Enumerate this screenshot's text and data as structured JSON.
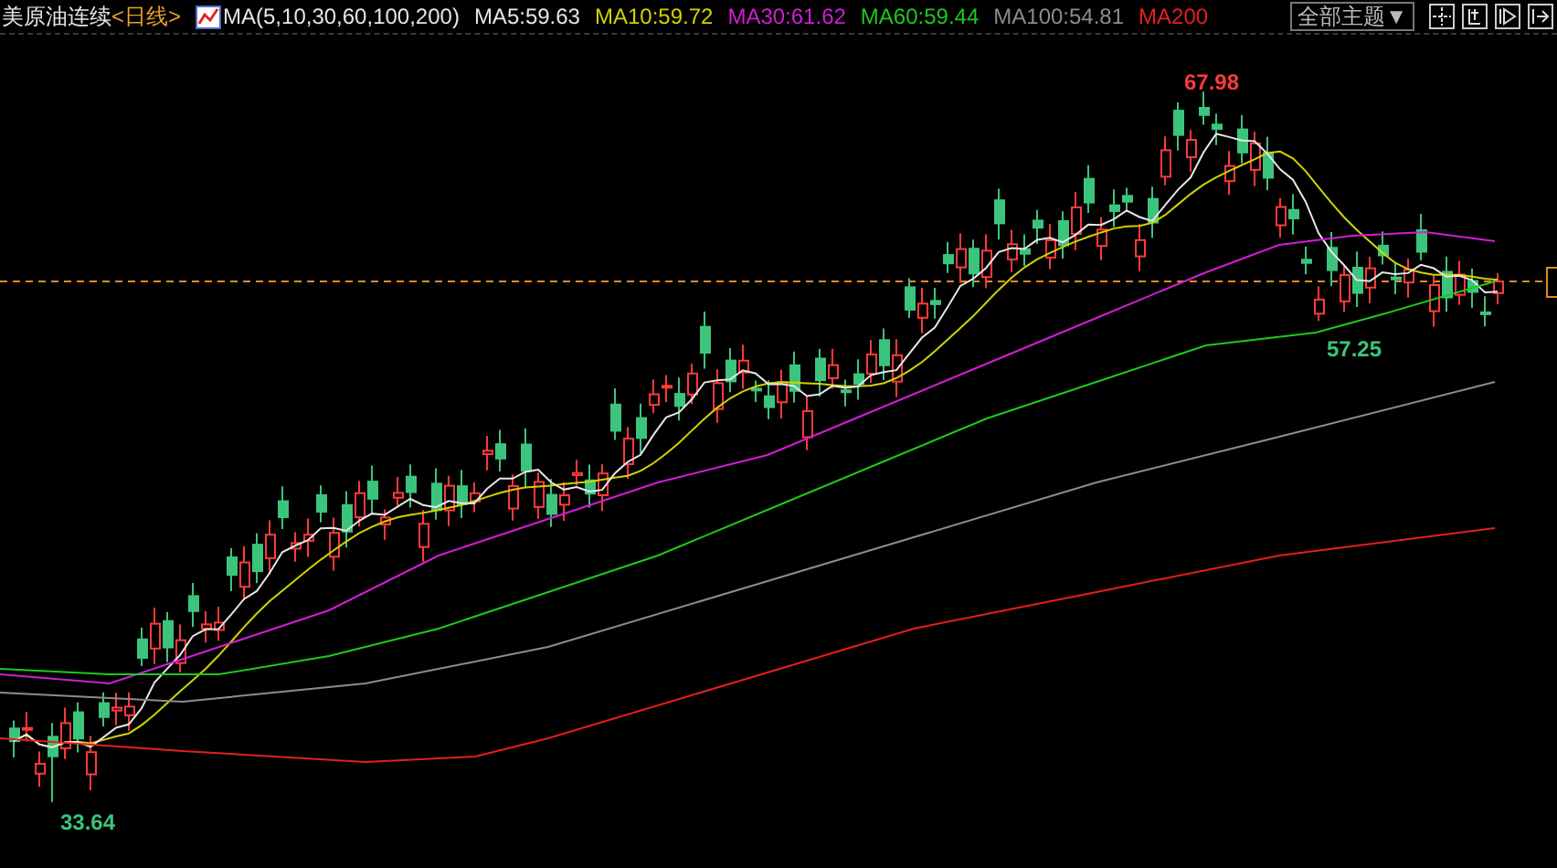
{
  "header": {
    "title": "美原油连续",
    "period": "<日线>",
    "indicator": "MA(5,10,30,60,100,200)",
    "ma_values": [
      {
        "label": "MA5:59.63",
        "color": "#e6e6e6"
      },
      {
        "label": "MA10:59.72",
        "color": "#d2d200"
      },
      {
        "label": "MA30:61.62",
        "color": "#d21ed2"
      },
      {
        "label": "MA60:59.44",
        "color": "#1ec81e"
      },
      {
        "label": "MA100:54.81",
        "color": "#8c8c8c"
      },
      {
        "label": "MA200",
        "color": "#e61e1e"
      }
    ],
    "theme_button": "全部主题▼"
  },
  "chart": {
    "high_label": "67.98",
    "recent_low_label": "57.25",
    "low_label": "33.64"
  }
}
